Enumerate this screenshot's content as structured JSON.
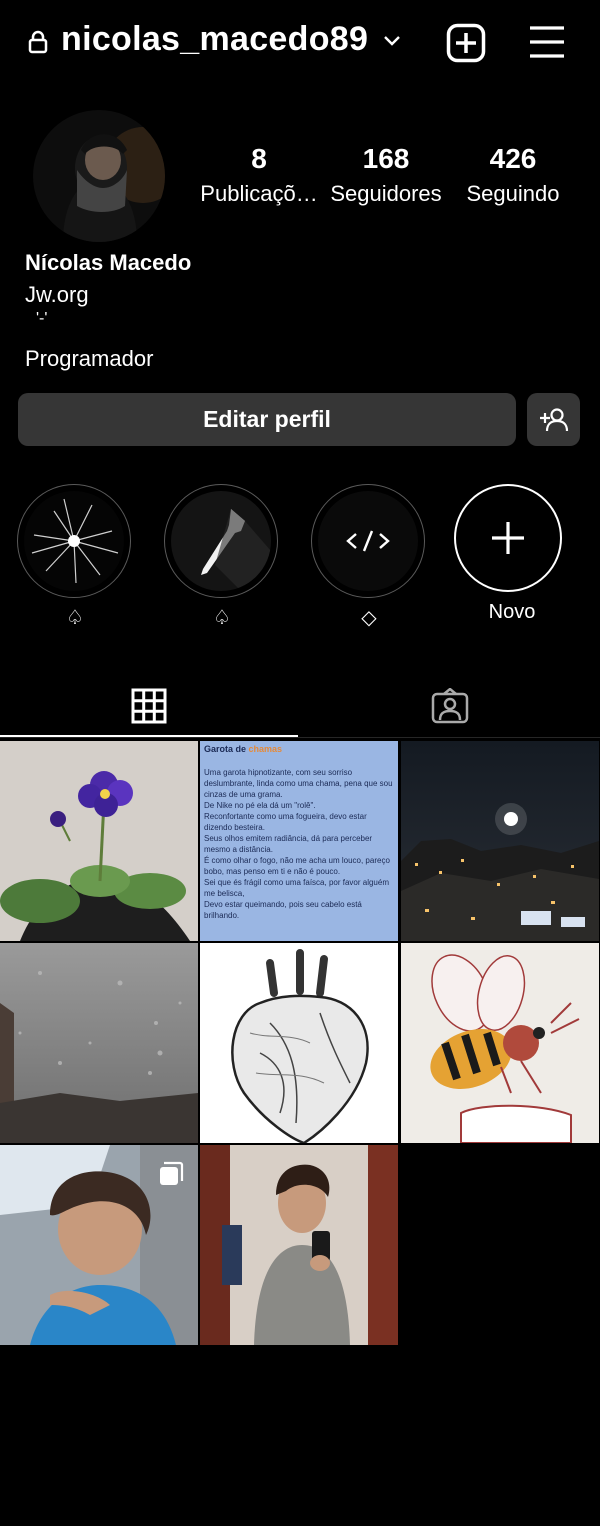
{
  "header": {
    "username": "nicolas_macedo89",
    "icons": [
      "lock-icon",
      "chevron-down-icon",
      "plus-square-icon",
      "hamburger-menu-icon"
    ]
  },
  "stats": {
    "posts": {
      "value": "8",
      "label": "Publicaçõ…"
    },
    "followers": {
      "value": "168",
      "label": "Seguidores"
    },
    "following": {
      "value": "426",
      "label": "Seguindo"
    }
  },
  "bio": {
    "name": "Nícolas Macedo",
    "website": "Jw.org",
    "emoticon": "'-'",
    "occupation": "Programador"
  },
  "actions": {
    "edit_profile": "Editar perfil",
    "discover_people_icon": "add-person-icon"
  },
  "highlights": [
    {
      "caption": "♤",
      "icon": "shattered-glass-thumb"
    },
    {
      "caption": "♤",
      "icon": "pen-nib-thumb"
    },
    {
      "caption": "◇",
      "icon": "code-tag-thumb"
    },
    {
      "caption": "Novo",
      "icon": "plus-icon"
    }
  ],
  "tabs": [
    {
      "name": "grid",
      "icon": "grid-icon",
      "active": true
    },
    {
      "name": "tagged",
      "icon": "tagged-person-icon",
      "active": false
    }
  ],
  "posts": [
    {
      "subject": "flower"
    },
    {
      "subject": "poem",
      "poem_title": "Garota de",
      "poem_title_accent": "chamas",
      "poem_lines": [
        "Uma garota hipnotizante, com seu sorriso deslumbrante, linda como uma chama, pena que sou cinzas de uma grama.",
        "De Nike no pé ela dá um \"rolê\".",
        "Reconfortante como uma fogueira, devo estar dizendo besteira.",
        "Seus olhos emitem radiância, dá para perceber mesmo a distância.",
        "É como olhar o fogo, não me acha um louco, pareço bobo, mas penso em ti e não é pouco.",
        "Sei que és frágil como uma faísca, por favor alguém me belisca,",
        "Devo estar queimando, pois seu cabelo está brilhando."
      ]
    },
    {
      "subject": "night-city"
    },
    {
      "subject": "rain-window"
    },
    {
      "subject": "heart-drawing"
    },
    {
      "subject": "bee-drawing"
    },
    {
      "subject": "selfie-car",
      "multi": true
    },
    {
      "subject": "mirror-selfie"
    }
  ],
  "colors": {
    "background": "#000000",
    "button": "#363636",
    "text": "#ffffff",
    "poem_bg": "#9ab6e3"
  }
}
